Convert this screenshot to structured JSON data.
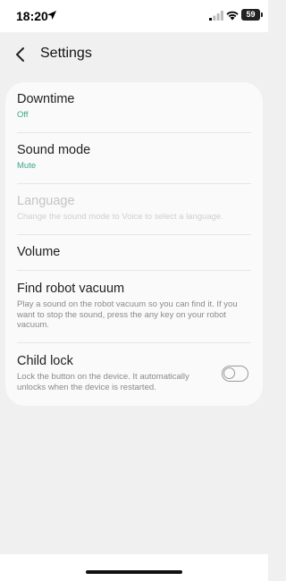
{
  "status": {
    "time": "18:20",
    "battery": "59",
    "icons": [
      "location-arrow-icon",
      "signal-icon",
      "wifi-icon",
      "battery-icon"
    ]
  },
  "header": {
    "title": "Settings",
    "back_icon": "chevron-left-icon"
  },
  "settings": {
    "downtime": {
      "title": "Downtime",
      "value": "Off"
    },
    "sound_mode": {
      "title": "Sound mode",
      "value": "Mute"
    },
    "language": {
      "title": "Language",
      "description": "Change the sound mode to Voice to select a language.",
      "enabled": false
    },
    "volume": {
      "title": "Volume"
    },
    "find_robot": {
      "title": "Find robot vacuum",
      "description": "Play a sound on the robot vacuum so you can find it. If you want to stop the sound, press the any key on your robot vacuum."
    },
    "child_lock": {
      "title": "Child lock",
      "description": "Lock the button on the device. It automatically unlocks when the device is restarted.",
      "on": false
    }
  },
  "colors": {
    "accent": "#3aa88a",
    "background": "#f0f0f0",
    "card": "#fafafa",
    "disabled_text": "#c4c4c4"
  }
}
